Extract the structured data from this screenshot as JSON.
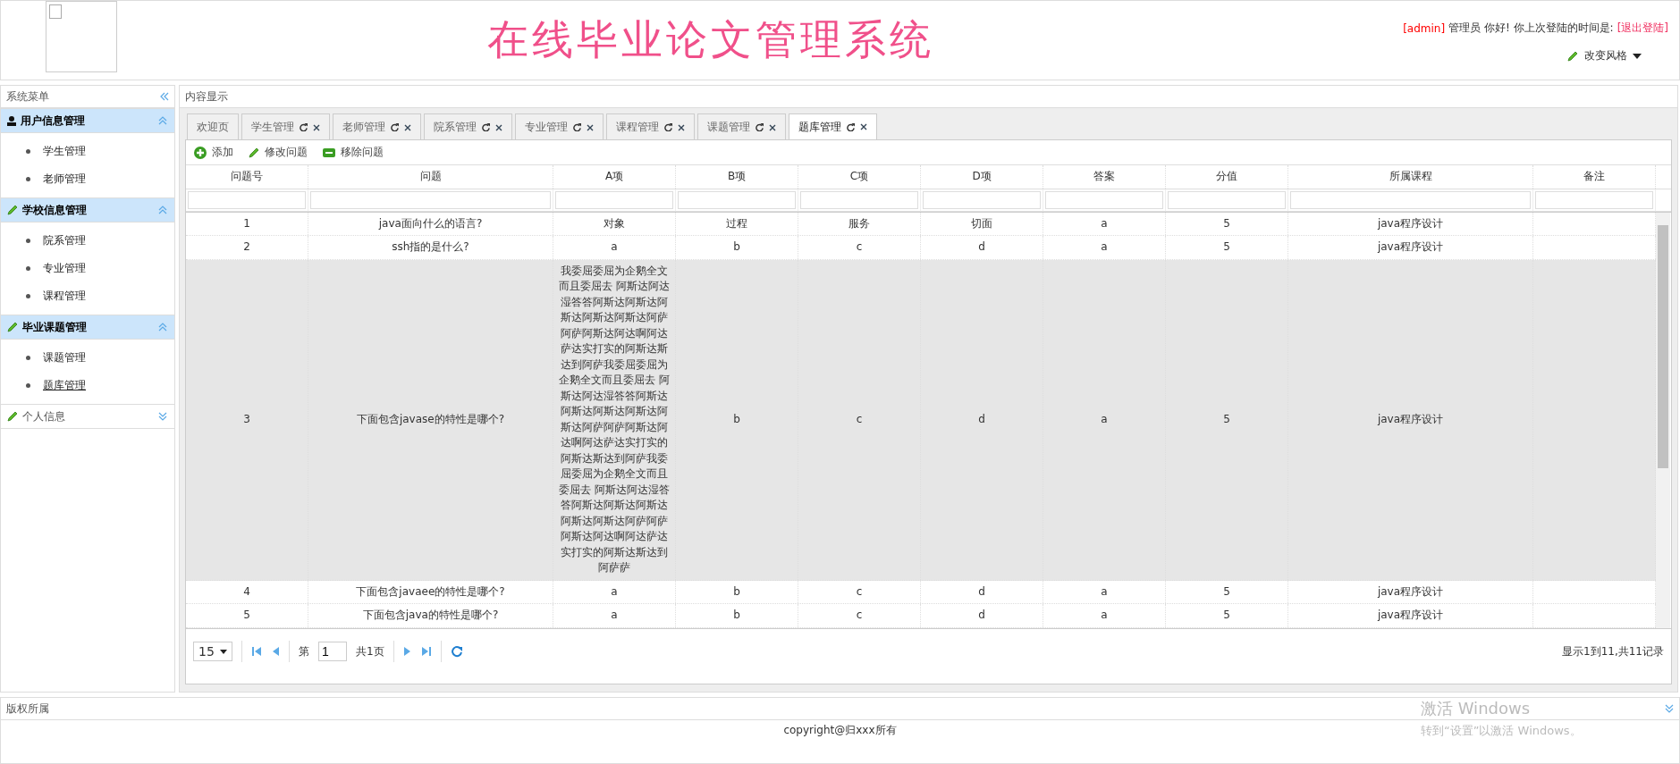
{
  "header": {
    "title": "在线毕业论文管理系统",
    "user": "[admin]",
    "greeting": "管理员 你好! 你上次登陆的时间是:",
    "logout": "[退出登陆]",
    "theme_menu": "改变风格"
  },
  "sidebar": {
    "title": "系统菜单",
    "groups": [
      {
        "title": "用户信息管理",
        "kind": "user",
        "expanded": true,
        "items": [
          {
            "label": "学生管理",
            "selected": false
          },
          {
            "label": "老师管理",
            "selected": false
          }
        ]
      },
      {
        "title": "学校信息管理",
        "kind": "pencil",
        "expanded": true,
        "items": [
          {
            "label": "院系管理",
            "selected": false
          },
          {
            "label": "专业管理",
            "selected": false
          },
          {
            "label": "课程管理",
            "selected": false
          }
        ]
      },
      {
        "title": "毕业课题管理",
        "kind": "pencil",
        "expanded": true,
        "items": [
          {
            "label": "课题管理",
            "selected": false
          },
          {
            "label": "题库管理",
            "selected": true
          }
        ]
      },
      {
        "title": "个人信息",
        "kind": "pencil",
        "expanded": false
      }
    ]
  },
  "content": {
    "title": "内容显示",
    "tabs": [
      {
        "label": "欢迎页",
        "selected": false,
        "closable": false
      },
      {
        "label": "学生管理",
        "selected": false,
        "closable": true
      },
      {
        "label": "老师管理",
        "selected": false,
        "closable": true
      },
      {
        "label": "院系管理",
        "selected": false,
        "closable": true
      },
      {
        "label": "专业管理",
        "selected": false,
        "closable": true
      },
      {
        "label": "课程管理",
        "selected": false,
        "closable": true
      },
      {
        "label": "课题管理",
        "selected": false,
        "closable": true
      },
      {
        "label": "题库管理",
        "selected": true,
        "closable": true
      }
    ],
    "toolbar": [
      {
        "kind": "add",
        "label": "添加"
      },
      {
        "kind": "edit",
        "label": "修改问题"
      },
      {
        "kind": "remove",
        "label": "移除问题"
      }
    ],
    "table": {
      "columns": [
        "问题号",
        "问题",
        "A项",
        "B项",
        "C项",
        "D项",
        "答案",
        "分值",
        "所属课程",
        "备注"
      ],
      "rows": [
        {
          "selected": false,
          "cells": [
            "1",
            "java面向什么的语言?",
            "对象",
            "过程",
            "服务",
            "切面",
            "a",
            "5",
            "java程序设计"
          ]
        },
        {
          "selected": false,
          "cells": [
            "2",
            "ssh指的是什么?",
            "a",
            "b",
            "c",
            "d",
            "a",
            "5",
            "java程序设计"
          ]
        },
        {
          "selected": true,
          "cells": [
            "3",
            "下面包含javase的特性是哪个?",
            "我委屈委屈为企鹅全文而且委屈去 阿斯达阿达湿答答阿斯达阿斯达阿斯达阿斯达阿斯达阿萨阿萨阿斯达阿达啊阿达萨达实打实的阿斯达斯达到阿萨我委屈委屈为企鹅全文而且委屈去 阿斯达阿达湿答答阿斯达阿斯达阿斯达阿斯达阿斯达阿萨阿萨阿斯达阿达啊阿达萨达实打实的阿斯达斯达到阿萨我委屈委屈为企鹅全文而且委屈去 阿斯达阿达湿答答阿斯达阿斯达阿斯达阿斯达阿斯达阿萨阿萨阿斯达阿达啊阿达萨达实打实的阿斯达斯达到阿萨萨",
            "b",
            "c",
            "d",
            "a",
            "5",
            "java程序设计"
          ]
        },
        {
          "selected": false,
          "cells": [
            "4",
            "下面包含javaee的特性是哪个?",
            "a",
            "b",
            "c",
            "d",
            "a",
            "5",
            "java程序设计"
          ]
        },
        {
          "selected": false,
          "cells": [
            "5",
            "下面包含java的特性是哪个?",
            "a",
            "b",
            "c",
            "d",
            "a",
            "5",
            "java程序设计"
          ]
        }
      ]
    },
    "pagination": {
      "page_size": "15",
      "page_prefix": "第",
      "page": "1",
      "total_pages": "共1页",
      "summary": "显示1到11,共11记录"
    }
  },
  "footer": {
    "title": "版权所属",
    "text": "copyright@归xxx所有"
  },
  "os_overlay": {
    "title": "激活 Windows",
    "text": "转到“设置”以激活 Windows。"
  }
}
